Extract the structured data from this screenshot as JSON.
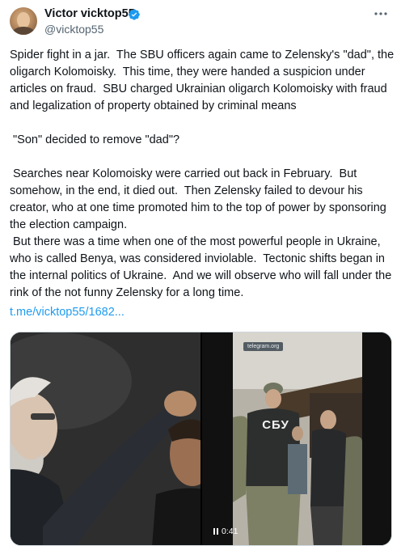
{
  "author": {
    "name": "Victor vicktop55",
    "handle": "@vicktop55"
  },
  "tweet": {
    "paragraphs": [
      "Spider fight in a jar.  The SBU officers again came to Zelensky's \"dad\", the oligarch Kolomoisky.  This time, they were handed a suspicion under articles on fraud.  SBU charged Ukrainian oligarch Kolomoisky with fraud and legalization of property obtained by criminal means",
      " \"Son\" decided to remove \"dad\"?",
      " Searches near Kolomoisky were carried out back in February.  But somehow, in the end, it died out.  Then Zelensky failed to devour his creator, who at one time promoted him to the top of power by sponsoring the election campaign.\n But there was a time when one of the most powerful people in Ukraine, who is called Benya, was considered inviolable.  Tectonic shifts began in the internal politics of Ukraine.  And we will observe who will fall under the rink of the not funny Zelensky for a long time."
    ],
    "link": "t.me/vicktop55/1682..."
  },
  "media": {
    "video_watermark": "telegram.org",
    "video_vest_text": "СБУ",
    "video_duration": "0:41"
  },
  "colors": {
    "accent": "#1d9bf0",
    "text": "#0f1419",
    "muted": "#536471"
  },
  "icons": [
    "verified-badge-icon",
    "more-options-icon",
    "pause-icon"
  ]
}
